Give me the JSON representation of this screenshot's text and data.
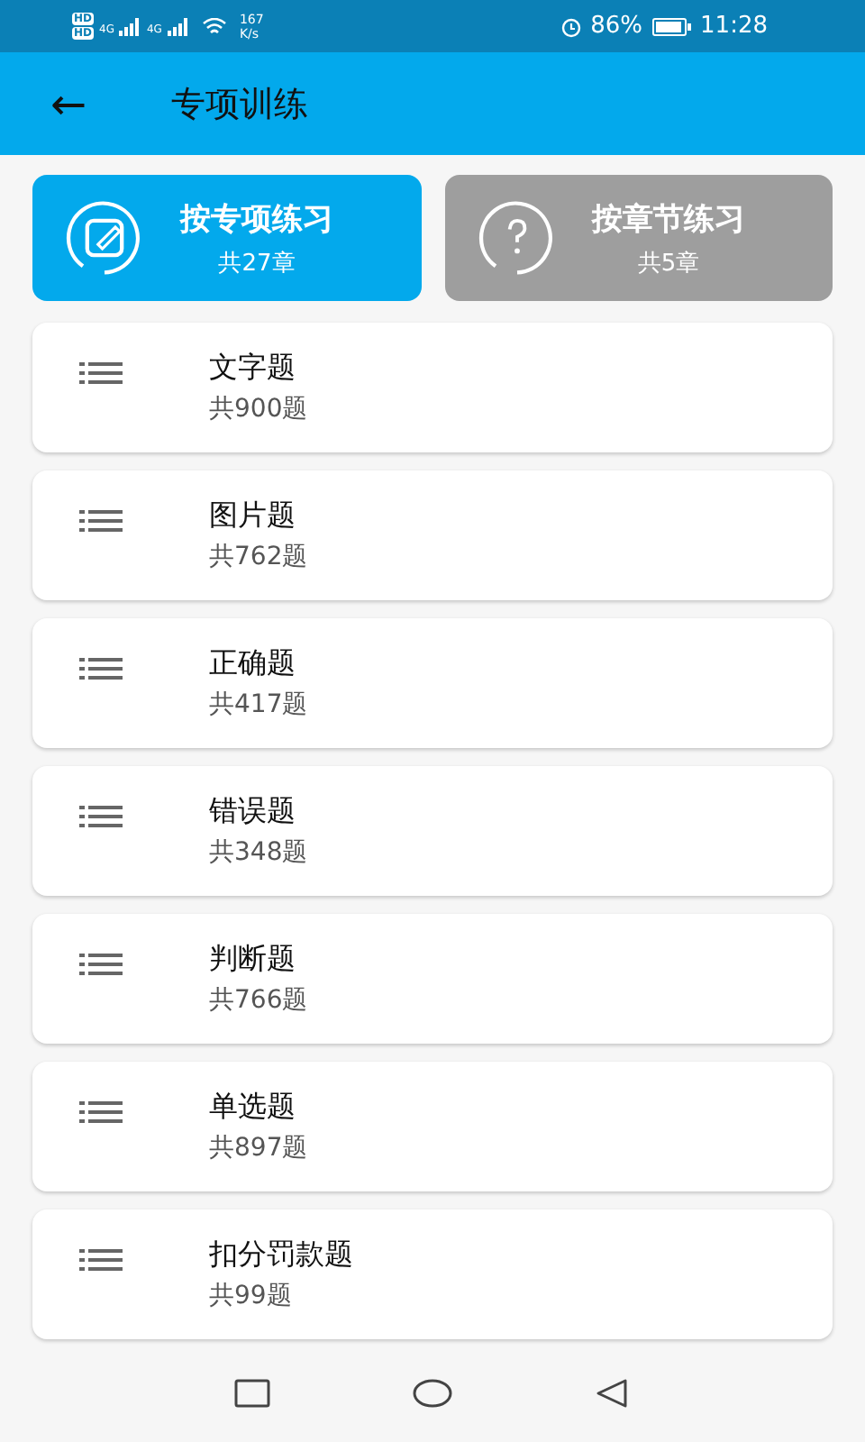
{
  "status_bar": {
    "sims": [
      {
        "hd": "HD",
        "network": "4G"
      },
      {
        "hd": "HD",
        "network": "4G"
      }
    ],
    "speed_value": "167",
    "speed_unit": "K/s",
    "battery": "86%",
    "time": "11:28"
  },
  "app_bar": {
    "back": "←",
    "title": "专项训练"
  },
  "modes": [
    {
      "kind": "edit",
      "label": "按专项练习",
      "count": "共27章",
      "selected": true
    },
    {
      "kind": "question",
      "label": "按章节练习",
      "count": "共5章",
      "selected": false
    }
  ],
  "items": [
    {
      "title": "文字题",
      "count": "共900题"
    },
    {
      "title": "图片题",
      "count": "共762题"
    },
    {
      "title": "正确题",
      "count": "共417题"
    },
    {
      "title": "错误题",
      "count": "共348题"
    },
    {
      "title": "判断题",
      "count": "共766题"
    },
    {
      "title": "单选题",
      "count": "共897题"
    },
    {
      "title": "扣分罚款题",
      "count": "共99题"
    }
  ]
}
